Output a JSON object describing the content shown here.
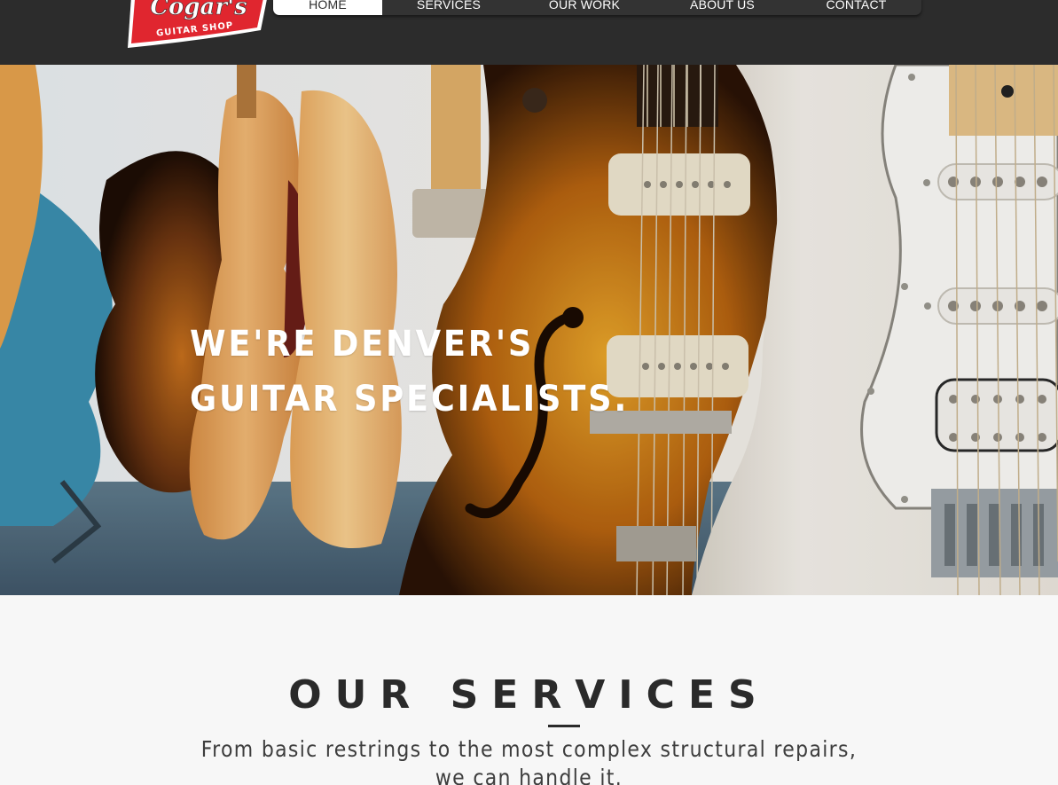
{
  "header": {
    "logo": {
      "wordmark": "Cogar's",
      "tagline": "GUITAR SHOP"
    },
    "nav": [
      {
        "label": "HOME",
        "active": true
      },
      {
        "label": "SERVICES",
        "active": false
      },
      {
        "label": "OUR WORK",
        "active": false
      },
      {
        "label": "ABOUT US",
        "active": false
      },
      {
        "label": "CONTACT",
        "active": false
      }
    ]
  },
  "hero": {
    "title_line1": "WE'RE DENVER'S",
    "title_line2": "GUITAR SPECIALISTS."
  },
  "services": {
    "title": "OUR SERVICES",
    "subtitle_line1": "From basic restrings to the most complex structural repairs,",
    "subtitle_line2": "we can handle it."
  },
  "colors": {
    "header_bg": "#2c2c2c",
    "logo_red": "#e0262f",
    "section_bg": "#f7f7f7",
    "text_dark": "#2a2a2a"
  }
}
